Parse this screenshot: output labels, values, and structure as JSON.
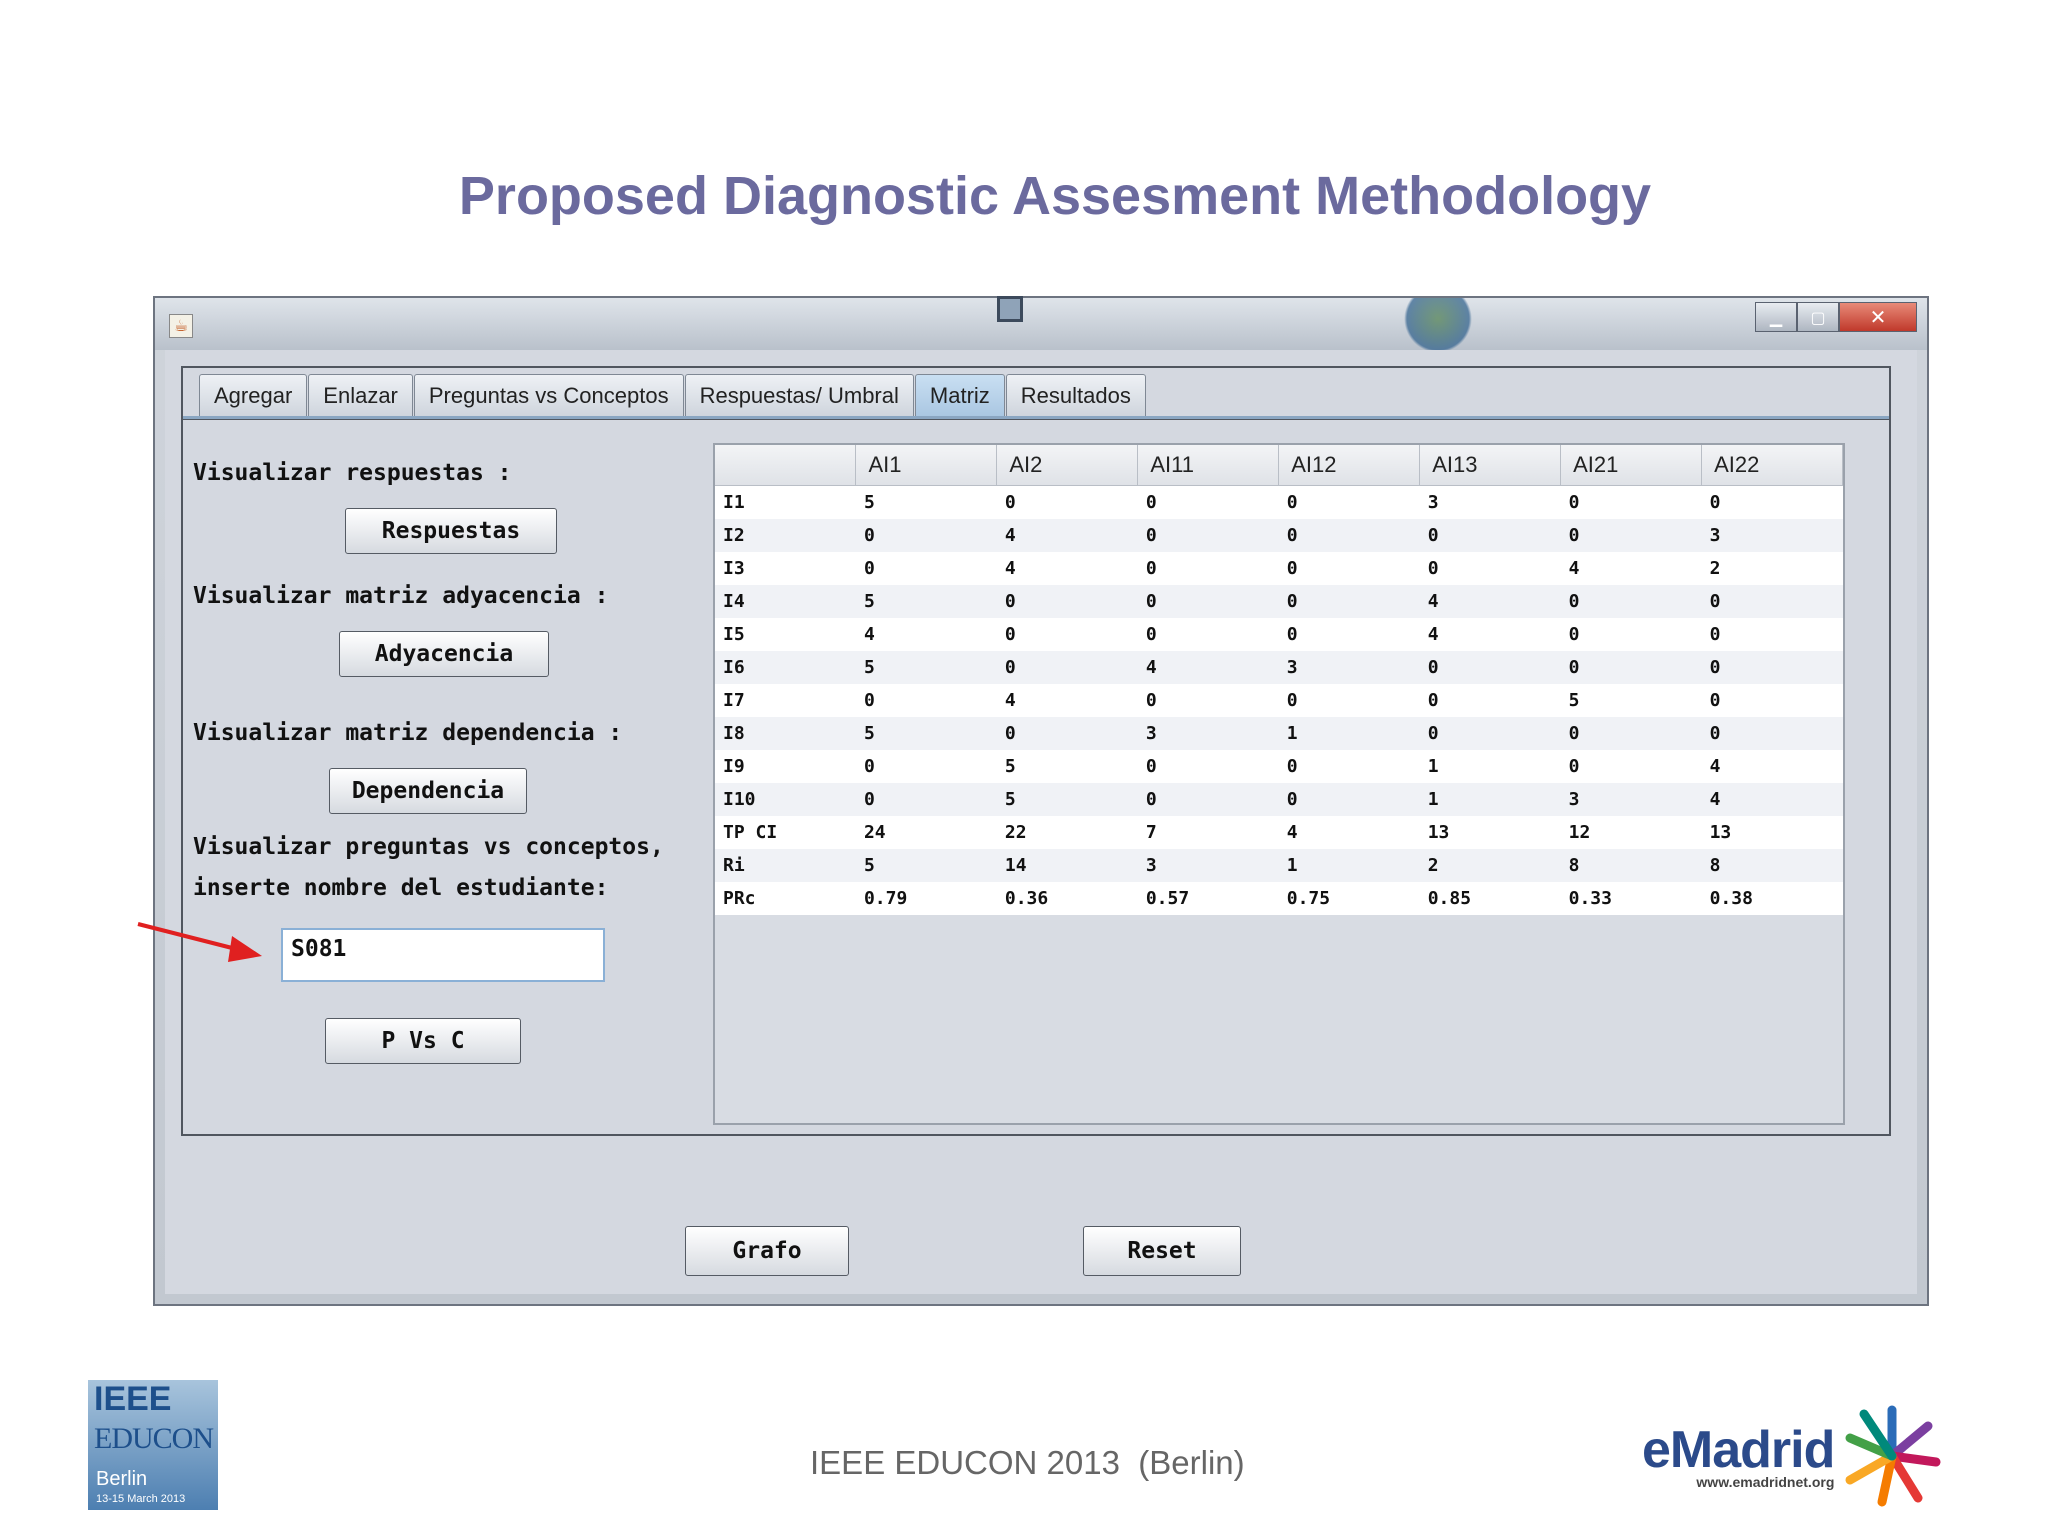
{
  "slide": {
    "title": "Proposed Diagnostic Assesment Methodology",
    "footer": "IEEE EDUCON 2013  (Berlin)"
  },
  "window": {
    "tabs": [
      "Agregar",
      "Enlazar",
      "Preguntas vs Conceptos",
      "Respuestas/ Umbral",
      "Matriz",
      "Resultados"
    ],
    "active_tab": "Matriz",
    "left_panel": {
      "label_respuestas": "Visualizar respuestas :",
      "btn_respuestas": "Respuestas",
      "label_adyacencia": "Visualizar matriz adyacencia :",
      "btn_adyacencia": "Adyacencia",
      "label_dependencia": "Visualizar matriz dependencia :",
      "btn_dependencia": "Dependencia",
      "label_pvc_line1": "Visualizar preguntas vs conceptos,",
      "label_pvc_line2": "inserte nombre del estudiante:",
      "student_input_value": "S081",
      "btn_pvc": "P Vs C"
    },
    "bottom_buttons": {
      "grafo": "Grafo",
      "reset": "Reset"
    },
    "table": {
      "headers": [
        "",
        "AI1",
        "AI2",
        "AI11",
        "AI12",
        "AI13",
        "AI21",
        "AI22"
      ],
      "rows": [
        [
          "I1",
          "5",
          "0",
          "0",
          "0",
          "3",
          "0",
          "0"
        ],
        [
          "I2",
          "0",
          "4",
          "0",
          "0",
          "0",
          "0",
          "3"
        ],
        [
          "I3",
          "0",
          "4",
          "0",
          "0",
          "0",
          "4",
          "2"
        ],
        [
          "I4",
          "5",
          "0",
          "0",
          "0",
          "4",
          "0",
          "0"
        ],
        [
          "I5",
          "4",
          "0",
          "0",
          "0",
          "4",
          "0",
          "0"
        ],
        [
          "I6",
          "5",
          "0",
          "4",
          "3",
          "0",
          "0",
          "0"
        ],
        [
          "I7",
          "0",
          "4",
          "0",
          "0",
          "0",
          "5",
          "0"
        ],
        [
          "I8",
          "5",
          "0",
          "3",
          "1",
          "0",
          "0",
          "0"
        ],
        [
          "I9",
          "0",
          "5",
          "0",
          "0",
          "1",
          "0",
          "4"
        ],
        [
          "I10",
          "0",
          "5",
          "0",
          "0",
          "1",
          "3",
          "4"
        ],
        [
          "TP CI",
          "24",
          "22",
          "7",
          "4",
          "13",
          "12",
          "13"
        ],
        [
          "Ri",
          "5",
          "14",
          "3",
          "1",
          "2",
          "8",
          "8"
        ],
        [
          "PRc",
          "0.79",
          "0.36",
          "0.57",
          "0.75",
          "0.85",
          "0.33",
          "0.38"
        ]
      ]
    }
  },
  "logos": {
    "ieee_line1": "IEEE",
    "ieee_line2": "EDUCON",
    "ieee_line3": "Berlin",
    "ieee_line4": "13-15 March 2013",
    "emadrid_e": "e",
    "emadrid_rest": "Madrid",
    "emadrid_url": "www.emadridnet.org"
  },
  "colors": {
    "title": "#6b6a9e",
    "arrow": "#e02020",
    "active_tab": "#aac7e2"
  }
}
